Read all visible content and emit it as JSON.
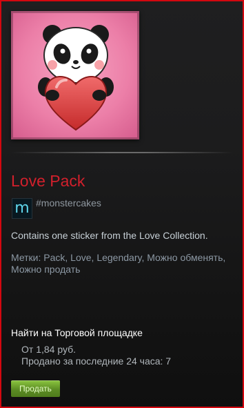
{
  "item": {
    "title": "Love Pack",
    "title_color": "#d2202c",
    "image_name": "panda-heart-sticker-image",
    "game_icon_letter": "m",
    "game_name": "#monstercakes",
    "description": "Contains one sticker from the Love Collection.",
    "tags": "Метки: Pack, Love, Legendary, Можно обменять, Можно продать"
  },
  "market": {
    "heading": "Найти на Торговой площадке",
    "price": "От 1,84 руб.",
    "sold": "Продано за последние 24 часа: 7",
    "sell_label": "Продать"
  },
  "colors": {
    "border": "#d4070f",
    "sell_button": "#6a9e2a"
  }
}
